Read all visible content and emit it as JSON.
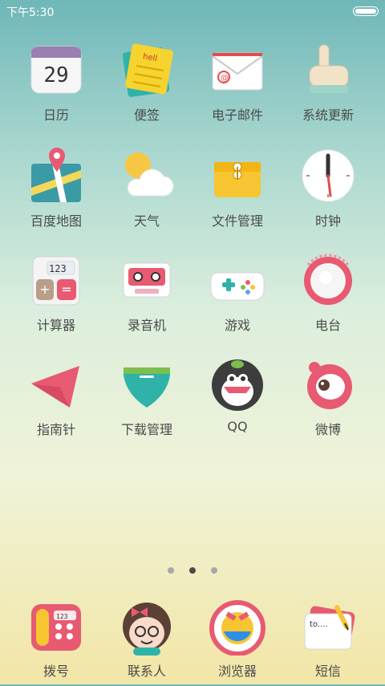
{
  "status_bar": {
    "time": "下午5:30"
  },
  "apps": [
    {
      "label": "日历",
      "icon": "calendar-icon",
      "day": "29"
    },
    {
      "label": "便签",
      "icon": "notes-icon",
      "note": "hell"
    },
    {
      "label": "电子邮件",
      "icon": "email-icon"
    },
    {
      "label": "系统更新",
      "icon": "system-update-icon"
    },
    {
      "label": "百度地图",
      "icon": "map-icon"
    },
    {
      "label": "天气",
      "icon": "weather-icon"
    },
    {
      "label": "文件管理",
      "icon": "folder-icon"
    },
    {
      "label": "时钟",
      "icon": "clock-icon"
    },
    {
      "label": "计算器",
      "icon": "calculator-icon",
      "display": "123"
    },
    {
      "label": "录音机",
      "icon": "recorder-icon"
    },
    {
      "label": "游戏",
      "icon": "gamepad-icon"
    },
    {
      "label": "电台",
      "icon": "radio-icon"
    },
    {
      "label": "指南针",
      "icon": "compass-icon"
    },
    {
      "label": "下载管理",
      "icon": "download-icon"
    },
    {
      "label": "QQ",
      "icon": "qq-penguin-icon"
    },
    {
      "label": "微博",
      "icon": "weibo-icon"
    }
  ],
  "page_indicator": {
    "count": 3,
    "active_index": 1
  },
  "dock": [
    {
      "label": "拨号",
      "icon": "phone-dialer-icon",
      "display": "123"
    },
    {
      "label": "联系人",
      "icon": "contacts-icon"
    },
    {
      "label": "浏览器",
      "icon": "browser-icon"
    },
    {
      "label": "短信",
      "icon": "messaging-icon",
      "note": "to...."
    }
  ]
}
